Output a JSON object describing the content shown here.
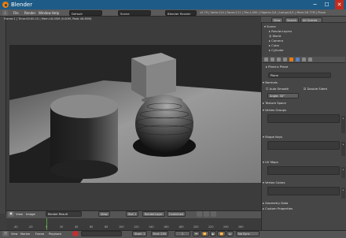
{
  "window": {
    "title": "Blender",
    "minimize": "─",
    "maximize": "☐",
    "close": "✕"
  },
  "menus": [
    "File",
    "Render",
    "Window",
    "Help"
  ],
  "layout_field": "Default",
  "scene_field": "Scene",
  "engine_field": "Blender Render",
  "stats": "v2.79 | Verts:114 | Faces:111 | Tris:1,000 | Objects:1/4 | Lamps:0/1 | Mem:26.77M | Plane",
  "viewport": {
    "info": "Frame:1 | Time:00:00.15 | Mem:18.05M (0.00M, Peak 46.65M)"
  },
  "outliner": {
    "view_label": "View",
    "search_label": "Search",
    "filter_label": "All Scenes",
    "items": [
      "Scene",
      "RenderLayers",
      "World",
      "Camera",
      "Cube",
      "Cylinder"
    ]
  },
  "properties": {
    "breadcrumb_1": "Plane",
    "breadcrumb_2": "Plane",
    "name_value": "Plane",
    "sections": {
      "normals": "Normals",
      "auto_smooth": "Auto Smooth",
      "double_sided": "Double Sided",
      "angle": "Angle: 30°",
      "texture_space": "Texture Space",
      "vertex_groups": "Vertex Groups",
      "shape_keys": "Shape Keys",
      "uv_maps": "UV Maps",
      "vertex_colors": "Vertex Colors",
      "geometry_data": "Geometry Data",
      "custom_properties": "Custom Properties"
    }
  },
  "image_editor_header": {
    "view": "View",
    "image": "Image",
    "image_name": "Render Result",
    "view_menu": "View",
    "slot": "Slot 1",
    "layer": "RenderLayer",
    "pass": "Combined"
  },
  "timeline": {
    "ticks": [
      "-40",
      "-20",
      "0",
      "20",
      "40",
      "60",
      "80",
      "100",
      "120",
      "140",
      "160",
      "180",
      "200",
      "220",
      "240",
      "260"
    ],
    "header": {
      "view": "View",
      "marker": "Marker",
      "frame": "Frame",
      "playback": "Playback",
      "start": "Start: 1",
      "end": "End: 250",
      "current": "1",
      "sync": "No Sync"
    }
  },
  "colors": {
    "titlebar": "#1e5b86",
    "accent_orange": "#e87d0d",
    "selection": "#5680c2"
  }
}
